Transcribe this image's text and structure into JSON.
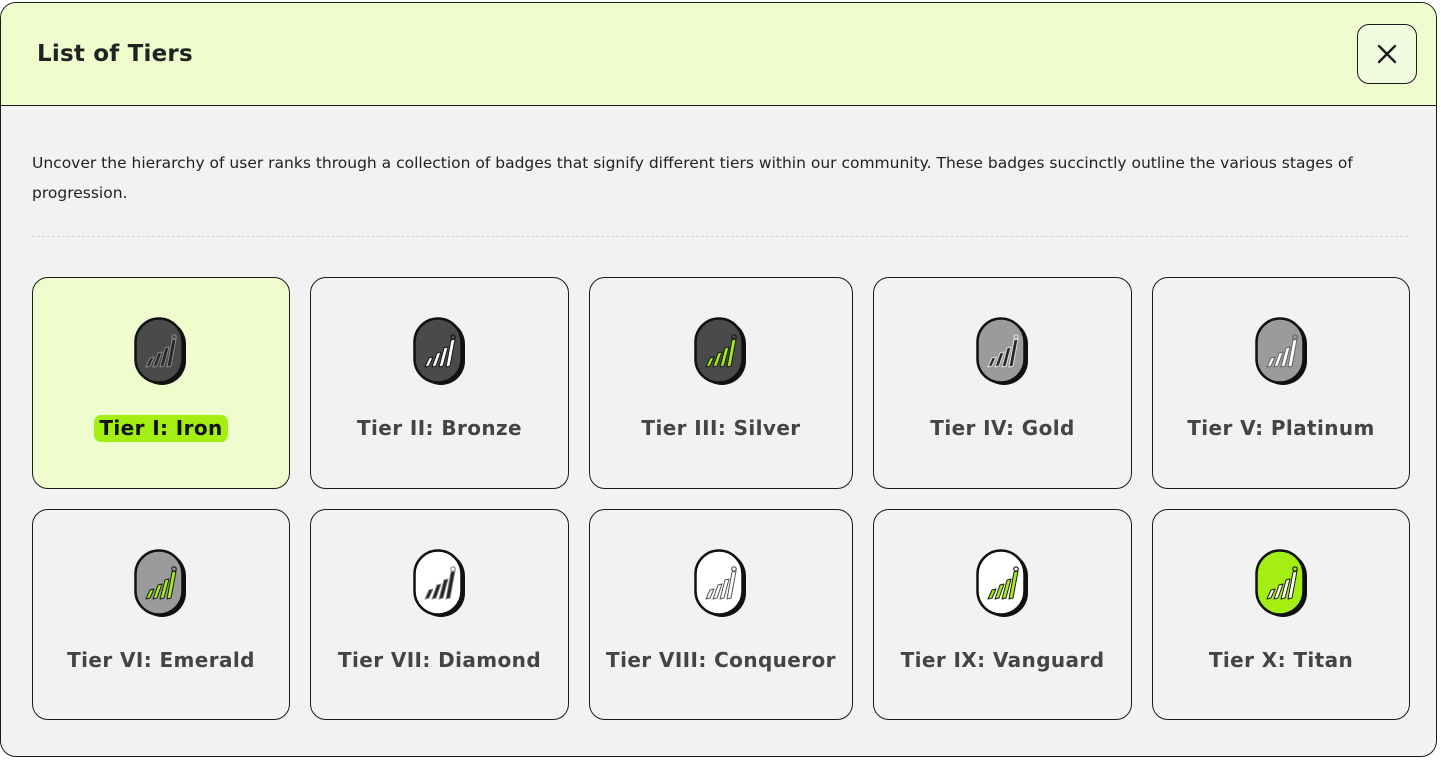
{
  "modal": {
    "title": "List of Tiers",
    "close_icon": "close-icon",
    "description": "Uncover the hierarchy of user ranks through a collection of badges that signify different tiers within our community. These badges succinctly outline the various stages of progression."
  },
  "colors": {
    "header_bg": "#effcce",
    "accent_green": "#a4ee14",
    "panel_bg": "#f2f2f2",
    "border": "#1a1a1a"
  },
  "tiers": [
    {
      "label": "Tier I: Iron",
      "selected": true,
      "icon": "tier-badge-icon",
      "badge_bg": "#4a4a4a",
      "mark_fill": "#262626",
      "mark_stroke": "#888888"
    },
    {
      "label": "Tier II: Bronze",
      "selected": false,
      "icon": "tier-badge-icon",
      "badge_bg": "#4a4a4a",
      "mark_fill": "#ffffff",
      "mark_stroke": "#1a1a1a"
    },
    {
      "label": "Tier III: Silver",
      "selected": false,
      "icon": "tier-badge-icon",
      "badge_bg": "#4a4a4a",
      "mark_fill": "#a4ee14",
      "mark_stroke": "#1a1a1a"
    },
    {
      "label": "Tier IV: Gold",
      "selected": false,
      "icon": "tier-badge-icon",
      "badge_bg": "#9b9b9b",
      "mark_fill": "#262626",
      "mark_stroke": "#e0e0e0"
    },
    {
      "label": "Tier V: Platinum",
      "selected": false,
      "icon": "tier-badge-icon",
      "badge_bg": "#9b9b9b",
      "mark_fill": "#ffffff",
      "mark_stroke": "#666666"
    },
    {
      "label": "Tier VI: Emerald",
      "selected": false,
      "icon": "tier-badge-icon",
      "badge_bg": "#9b9b9b",
      "mark_fill": "#a4ee14",
      "mark_stroke": "#1a1a1a"
    },
    {
      "label": "Tier VII: Diamond",
      "selected": false,
      "icon": "tier-badge-icon",
      "badge_bg": "#ffffff",
      "mark_fill": "#262626",
      "mark_stroke": "#888888"
    },
    {
      "label": "Tier VIII: Conqueror",
      "selected": false,
      "icon": "tier-badge-icon",
      "badge_bg": "#ffffff",
      "mark_fill": "#ffffff",
      "mark_stroke": "#555555"
    },
    {
      "label": "Tier IX: Vanguard",
      "selected": false,
      "icon": "tier-badge-icon",
      "badge_bg": "#ffffff",
      "mark_fill": "#a4ee14",
      "mark_stroke": "#1a1a1a"
    },
    {
      "label": "Tier X: Titan",
      "selected": false,
      "icon": "tier-badge-icon",
      "badge_bg": "#a4ee14",
      "mark_fill": "#ffffff",
      "mark_stroke": "#1a1a1a"
    }
  ]
}
